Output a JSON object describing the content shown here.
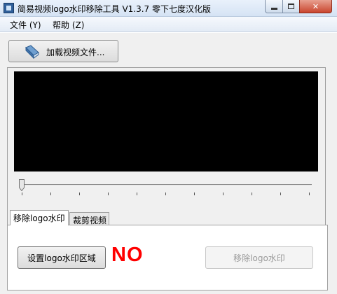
{
  "window": {
    "title": "简易视频logo水印移除工具 V1.3.7 零下七度汉化版",
    "min_glyph": "",
    "max_glyph": "",
    "close_glyph": "✕"
  },
  "menu": {
    "file": "文件 (Y)",
    "help": "帮助 (Z)"
  },
  "toolbar": {
    "load_video_label": "加载视频文件..."
  },
  "player": {
    "position": 0
  },
  "tabs": [
    {
      "label": "移除logo水印",
      "selected": true
    },
    {
      "label": "裁剪视频",
      "selected": false
    }
  ],
  "remove_panel": {
    "set_region_label": "设置logo水印区域",
    "status_text": "NO",
    "status_color": "#ff0000",
    "remove_label": "移除logo水印",
    "remove_enabled": false
  }
}
